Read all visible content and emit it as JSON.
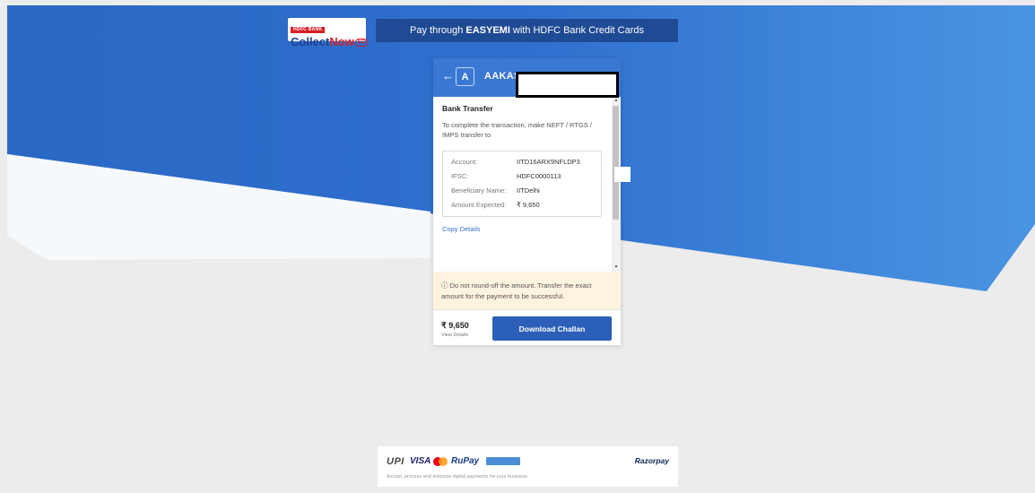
{
  "colors": {
    "header_blue": "#3a78d4",
    "banner_blue": "#1f4a94",
    "button_blue": "#2c5fb8",
    "notice_bg": "#fdf3df",
    "page_gray": "#ececec"
  },
  "logo": {
    "bank_label": "HDFC BANK",
    "brand_main": "Collect",
    "brand_accent": "Now",
    "brand_badge": "ED"
  },
  "emi_banner": {
    "prefix": "Pay through",
    "highlight": "EASYEMI",
    "suffix": "with HDFC Bank Credit Cards"
  },
  "card": {
    "back_icon": "←",
    "avatar_letter": "A",
    "merchant_name": "AAKAS",
    "section_title": "Bank Transfer",
    "instructions": "To complete the transaction, make NEFT / RTGS / IMPS transfer to",
    "details": {
      "account_label": "Account:",
      "account_value": "IITD16ARX9NFLDP3",
      "ifsc_label": "IFSC:",
      "ifsc_value": "HDFC0000113",
      "beneficiary_label": "Beneficiary Name:",
      "beneficiary_value": "IITDelhi",
      "amount_label": "Amount Expected:",
      "amount_value": "₹ 9,650"
    },
    "copy_link": "Copy Details",
    "notice": "ⓘ Do not round-off the amount. Transfer the exact amount for the payment to be successful.",
    "footer": {
      "amount": "₹ 9,650",
      "view_details": "View Details",
      "download_button": "Download Challan"
    }
  },
  "payment_methods": {
    "upi": "UPI",
    "visa": "VISA",
    "rupay": "RuPay",
    "brand": "Razorpay",
    "tagline": "Accept, process and disburse digital payments for your business."
  }
}
